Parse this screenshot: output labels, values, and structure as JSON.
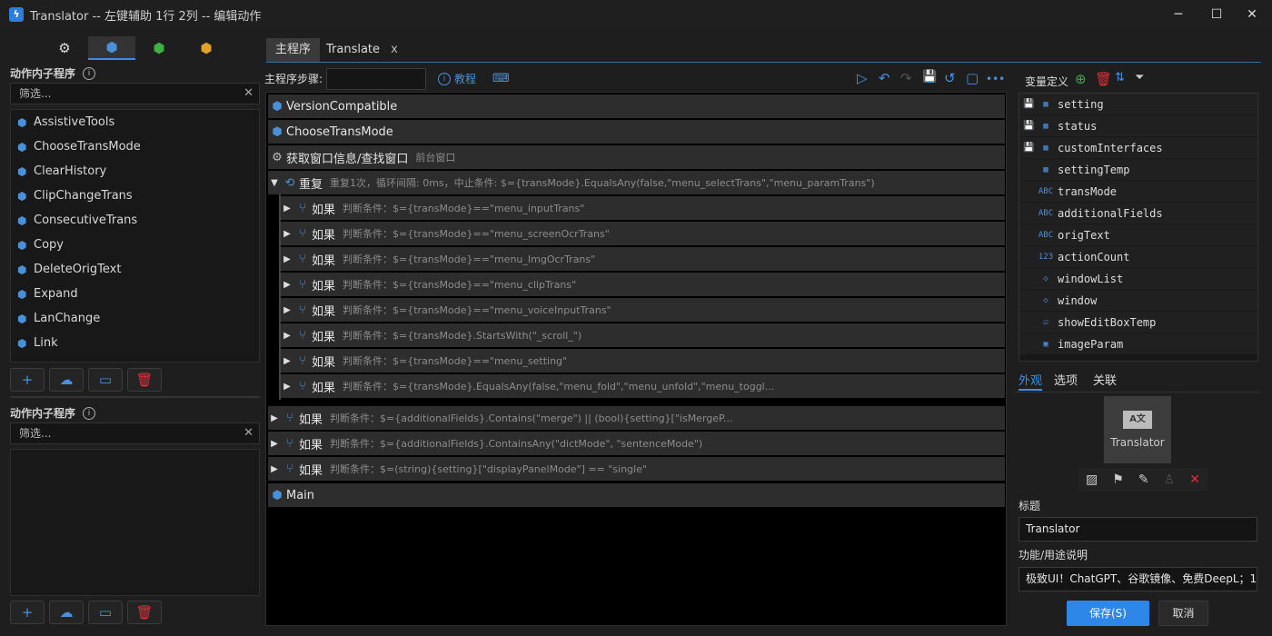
{
  "window": {
    "title": "Translator -- 左键辅助 1行 2列 -- 编辑动作",
    "app_icon": "lightning-icon",
    "minimize": "─",
    "maximize": "☐",
    "close": "✕"
  },
  "left": {
    "tabs": [
      {
        "icon": "gears-icon",
        "glyph": "⚙"
      },
      {
        "icon": "cubes-blue-icon",
        "glyph": "⬢"
      },
      {
        "icon": "cubes-green-icon",
        "glyph": "⬢"
      },
      {
        "icon": "cubes-orange-icon",
        "glyph": "⬢"
      }
    ],
    "section1_title": "动作内子程序",
    "section1_filter": "筛选...",
    "section1_items": [
      "AssistiveTools",
      "ChooseTransMode",
      "ClearHistory",
      "ClipChangeTrans",
      "ConsecutiveTrans",
      "Copy",
      "DeleteOrigText",
      "Expand",
      "LanChange",
      "Link"
    ],
    "section2_title": "动作内子程序",
    "section2_filter": "筛选...",
    "clear_glyph": "✕",
    "info_glyph": "i",
    "btn_add": "+",
    "btn_cloud": "☁",
    "btn_open": "▭",
    "btn_delete": "🗑"
  },
  "middle": {
    "tabs": [
      "主程序",
      "Translate"
    ],
    "tab_close": "x",
    "steps_label": "主程序步骤:",
    "tutorial": "教程",
    "toolbar": [
      "▷",
      "↶",
      "↷",
      "💾",
      "↺",
      "▢",
      "•••"
    ],
    "rows": {
      "version": "VersionCompatible",
      "choose": "ChooseTransMode",
      "window_info": "获取窗口信息/查找窗口",
      "window_info_sub": "前台窗口",
      "repeat": "重复",
      "repeat_cond": "重复1次，循环间隔: 0ms，中止条件: $={transMode}.EqualsAny(false,\"menu_selectTrans\",\"menu_paramTrans\")",
      "if_label": "如果",
      "inner_conds": [
        "判断条件：$={transMode}==\"menu_inputTrans\"",
        "判断条件：$={transMode}==\"menu_screenOcrTrans\"",
        "判断条件：$={transMode}==\"menu_ImgOcrTrans\"",
        "判断条件：$={transMode}==\"menu_clipTrans\"",
        "判断条件：$={transMode}==\"menu_voiceInputTrans\"",
        "判断条件：$={transMode}.StartsWith(\"_scroll_\")",
        "判断条件：$={transMode}==\"menu_setting\"",
        "判断条件：$={transMode}.EqualsAny(false,\"menu_fold\",\"menu_unfold\",\"menu_toggl..."
      ],
      "outer_conds": [
        "判断条件：$={additionalFields}.Contains(\"merge\") || (bool){setting}[\"isMergeP...",
        "判断条件：$={additionalFields}.ContainsAny(\"dictMode\", \"sentenceMode\")",
        "判断条件：$=(string){setting}[\"displayPanelMode\"] == \"single\""
      ],
      "main": "Main"
    }
  },
  "right": {
    "var_title": "变量定义",
    "variables": [
      {
        "name": "setting",
        "type": "dict",
        "saved": true
      },
      {
        "name": "status",
        "type": "dict",
        "saved": true
      },
      {
        "name": "customInterfaces",
        "type": "table",
        "saved": true
      },
      {
        "name": "settingTemp",
        "type": "dict",
        "saved": false
      },
      {
        "name": "transMode",
        "type": "ABC",
        "saved": false
      },
      {
        "name": "additionalFields",
        "type": "ABC",
        "saved": false
      },
      {
        "name": "origText",
        "type": "ABC",
        "saved": false
      },
      {
        "name": "actionCount",
        "type": "123",
        "saved": false
      },
      {
        "name": "windowList",
        "type": "◇",
        "saved": false
      },
      {
        "name": "window",
        "type": "◇",
        "saved": false
      },
      {
        "name": "showEditBoxTemp",
        "type": "☑",
        "saved": false
      },
      {
        "name": "imageParam",
        "type": "▣",
        "saved": false
      }
    ],
    "tabs": [
      "外观",
      "选项",
      "关联"
    ],
    "icon_glyph": "A文",
    "icon_name": "Translator",
    "title_label": "标题",
    "title_value": "Translator",
    "desc_label": "功能/用途说明",
    "desc_value": "极致UI！ChatGPT、谷歌镜像、免费DeepL；1",
    "save": "保存(S)",
    "cancel": "取消"
  },
  "colors": {
    "accent": "#3a8ee6",
    "danger": "#e0303a",
    "add_green": "#3cb043"
  }
}
